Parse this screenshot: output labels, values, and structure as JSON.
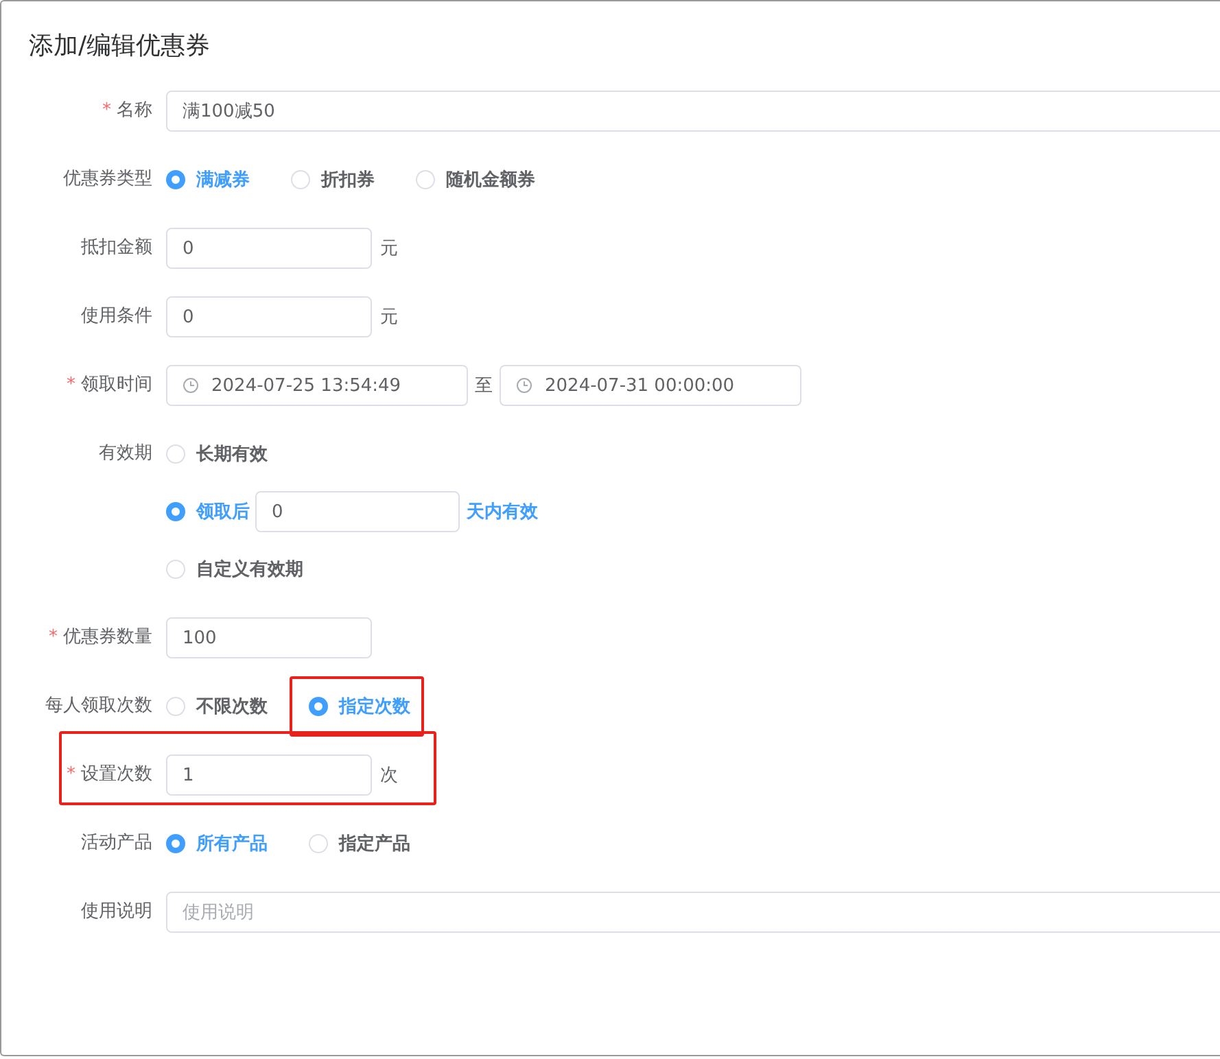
{
  "dialog": {
    "title": "添加/编辑优惠券"
  },
  "fields": [
    {
      "kind": "input",
      "label": "名称",
      "required_mark": "*",
      "value": "满100减50",
      "wide": true
    },
    {
      "kind": "radio",
      "label": "优惠券类型",
      "options": [
        {
          "label": "满减券",
          "selected": true
        },
        {
          "label": "折扣券",
          "selected": false
        },
        {
          "label": "随机金额券",
          "selected": false
        }
      ]
    },
    {
      "kind": "input",
      "label": "抵扣金额",
      "value": "0",
      "unit": "元"
    },
    {
      "kind": "input",
      "label": "使用条件",
      "value": "0",
      "unit": "元"
    },
    {
      "kind": "daterange",
      "label": "领取时间",
      "required_mark": "*",
      "start": "2024-07-25 13:54:49",
      "separator": "至",
      "end": "2024-07-31 00:00:00"
    },
    {
      "kind": "validity",
      "label": "有效期",
      "options": [
        {
          "label": "长期有效",
          "selected": false
        },
        {
          "label": "领取后",
          "selected": true,
          "value": "0",
          "suffix": "天内有效"
        },
        {
          "label": "自定义有效期",
          "selected": false
        }
      ]
    },
    {
      "kind": "input",
      "label": "优惠券数量",
      "required_mark": "*",
      "value": "100"
    },
    {
      "kind": "radio",
      "label": "每人领取次数",
      "options": [
        {
          "label": "不限次数",
          "selected": false
        },
        {
          "label": "指定次数",
          "selected": true,
          "highlighted": true
        }
      ]
    },
    {
      "kind": "input",
      "label": "设置次数",
      "required_mark": "*",
      "value": "1",
      "unit": "次",
      "highlighted": true
    },
    {
      "kind": "radio",
      "label": "活动产品",
      "options": [
        {
          "label": "所有产品",
          "selected": true
        },
        {
          "label": "指定产品",
          "selected": false
        }
      ]
    },
    {
      "kind": "input",
      "label": "使用说明",
      "placeholder": "使用说明",
      "wide": true
    }
  ]
}
